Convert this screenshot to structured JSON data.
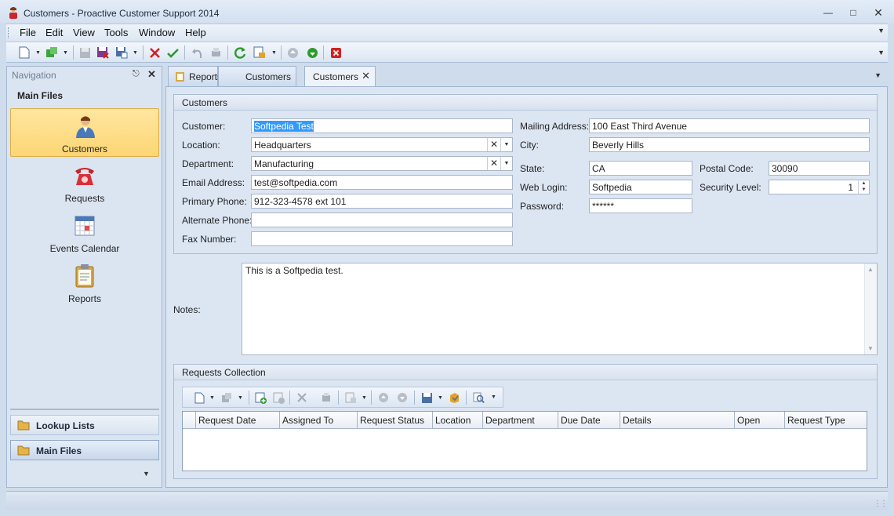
{
  "window": {
    "title": "Customers - Proactive Customer Support 2014"
  },
  "menu": [
    "File",
    "Edit",
    "View",
    "Tools",
    "Window",
    "Help"
  ],
  "navigation": {
    "header": "Navigation",
    "section": "Main Files",
    "items": [
      {
        "label": "Customers",
        "icon": "customer-icon",
        "selected": true
      },
      {
        "label": "Requests",
        "icon": "phone-icon"
      },
      {
        "label": "Events Calendar",
        "icon": "calendar-icon"
      },
      {
        "label": "Reports",
        "icon": "clipboard-icon"
      }
    ],
    "buttons": [
      {
        "label": "Lookup Lists",
        "icon": "folder-icon"
      },
      {
        "label": "Main Files",
        "icon": "folder-icon",
        "selected": true
      }
    ]
  },
  "tabs": [
    {
      "label": "Reports",
      "icon": "clipboard-icon"
    },
    {
      "label": "Customers"
    },
    {
      "label": "Customers",
      "active": true
    }
  ],
  "customers": {
    "group_title": "Customers",
    "labels": {
      "customer": "Customer:",
      "location": "Location:",
      "department": "Department:",
      "email": "Email Address:",
      "primary_phone": "Primary Phone:",
      "alternate_phone": "Alternate Phone:",
      "fax": "Fax Number:",
      "mailing_address": "Mailing Address:",
      "city": "City:",
      "state": "State:",
      "postal_code": "Postal Code:",
      "web_login": "Web Login:",
      "security_level": "Security Level:",
      "password": "Password:"
    },
    "values": {
      "customer": "Softpedia Test",
      "location": "Headquarters",
      "department": "Manufacturing",
      "email": "test@softpedia.com",
      "primary_phone": "912-323-4578 ext 101",
      "alternate_phone": "",
      "fax": "",
      "mailing_address": "100 East Third Avenue",
      "city": "Beverly Hills",
      "state": "CA",
      "postal_code": "30090",
      "web_login": "Softpedia",
      "security_level": "1",
      "password": "******"
    }
  },
  "notes": {
    "label": "Notes:",
    "value": "This is a Softpedia test."
  },
  "requests": {
    "group_title": "Requests Collection",
    "columns": [
      "Request Date",
      "Assigned To",
      "Request Status",
      "Location",
      "Department",
      "Due Date",
      "Details",
      "Open",
      "Request Type"
    ]
  },
  "colors": {
    "accent_selected": "#fcd673",
    "chrome": "#dce6f3",
    "selection": "#3399ff"
  }
}
